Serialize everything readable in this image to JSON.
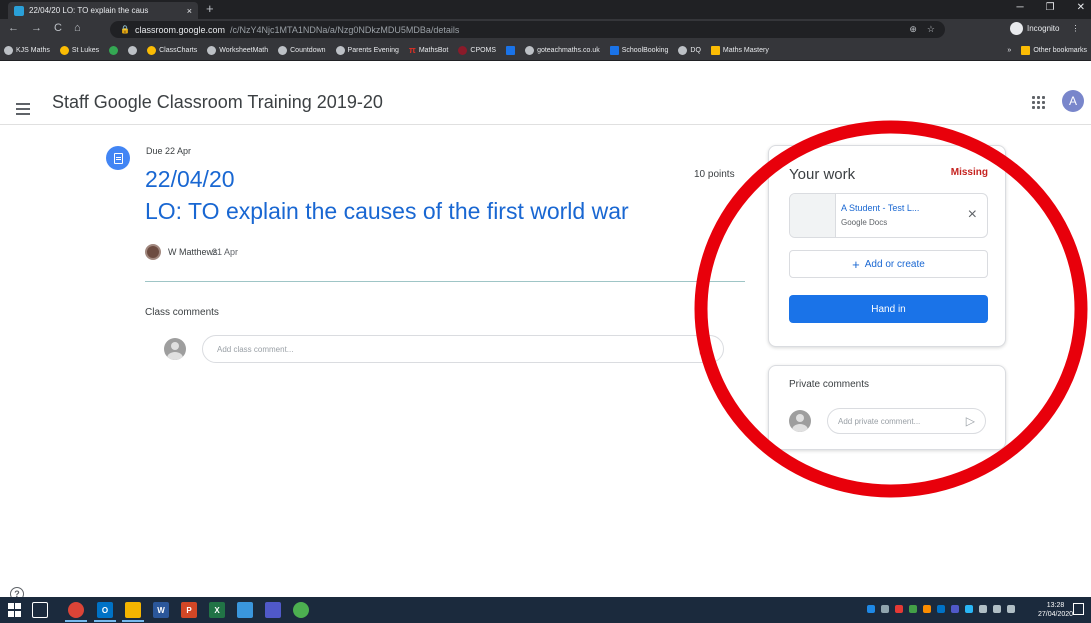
{
  "browser": {
    "tab_title": "22/04/20 LO: TO explain the caus",
    "tab_close": "×",
    "new_tab": "+",
    "url_host": "classroom.google.com",
    "url_path": "/c/NzY4Njc1MTA1NDNa/a/Nzg0NDkzMDU5MDBa/details",
    "incognito_label": "Incognito",
    "bookmarks": [
      "KJS Maths",
      "St Lukes",
      "ClassCharts",
      "WorksheetMath",
      "Countdown",
      "Parents Evening",
      "MathsBot",
      "CPOMS",
      "goteachmaths.co.uk",
      "SchoolBooking",
      "DQ",
      "Maths Mastery"
    ],
    "more_bookmarks": "»",
    "other_bookmarks": "Other bookmarks"
  },
  "header": {
    "title": "Staff Google Classroom Training 2019-20",
    "avatar_letter": "A"
  },
  "assignment": {
    "due": "Due 22 Apr",
    "date_line": "22/04/20",
    "title": "LO: TO explain the causes of the first world war",
    "points": "10 points",
    "author": "W Matthews",
    "posted": "21 Apr",
    "class_comments_label": "Class comments",
    "class_comment_placeholder": "Add class comment..."
  },
  "your_work": {
    "title": "Your work",
    "status": "Missing",
    "attachment_name": "A Student - Test L...",
    "attachment_type": "Google Docs",
    "attachment_close": "×",
    "add_create_plus": "+",
    "add_create_label": "Add or create",
    "hand_in_label": "Hand in"
  },
  "private_comments": {
    "title": "Private comments",
    "placeholder": "Add private comment..."
  },
  "taskbar": {
    "time": "13:28",
    "date": "27/04/2020"
  },
  "colors": {
    "accent": "#1a73e8",
    "link": "#1967d2",
    "missing": "#c5221f",
    "highlight_ring": "#e8000b"
  }
}
